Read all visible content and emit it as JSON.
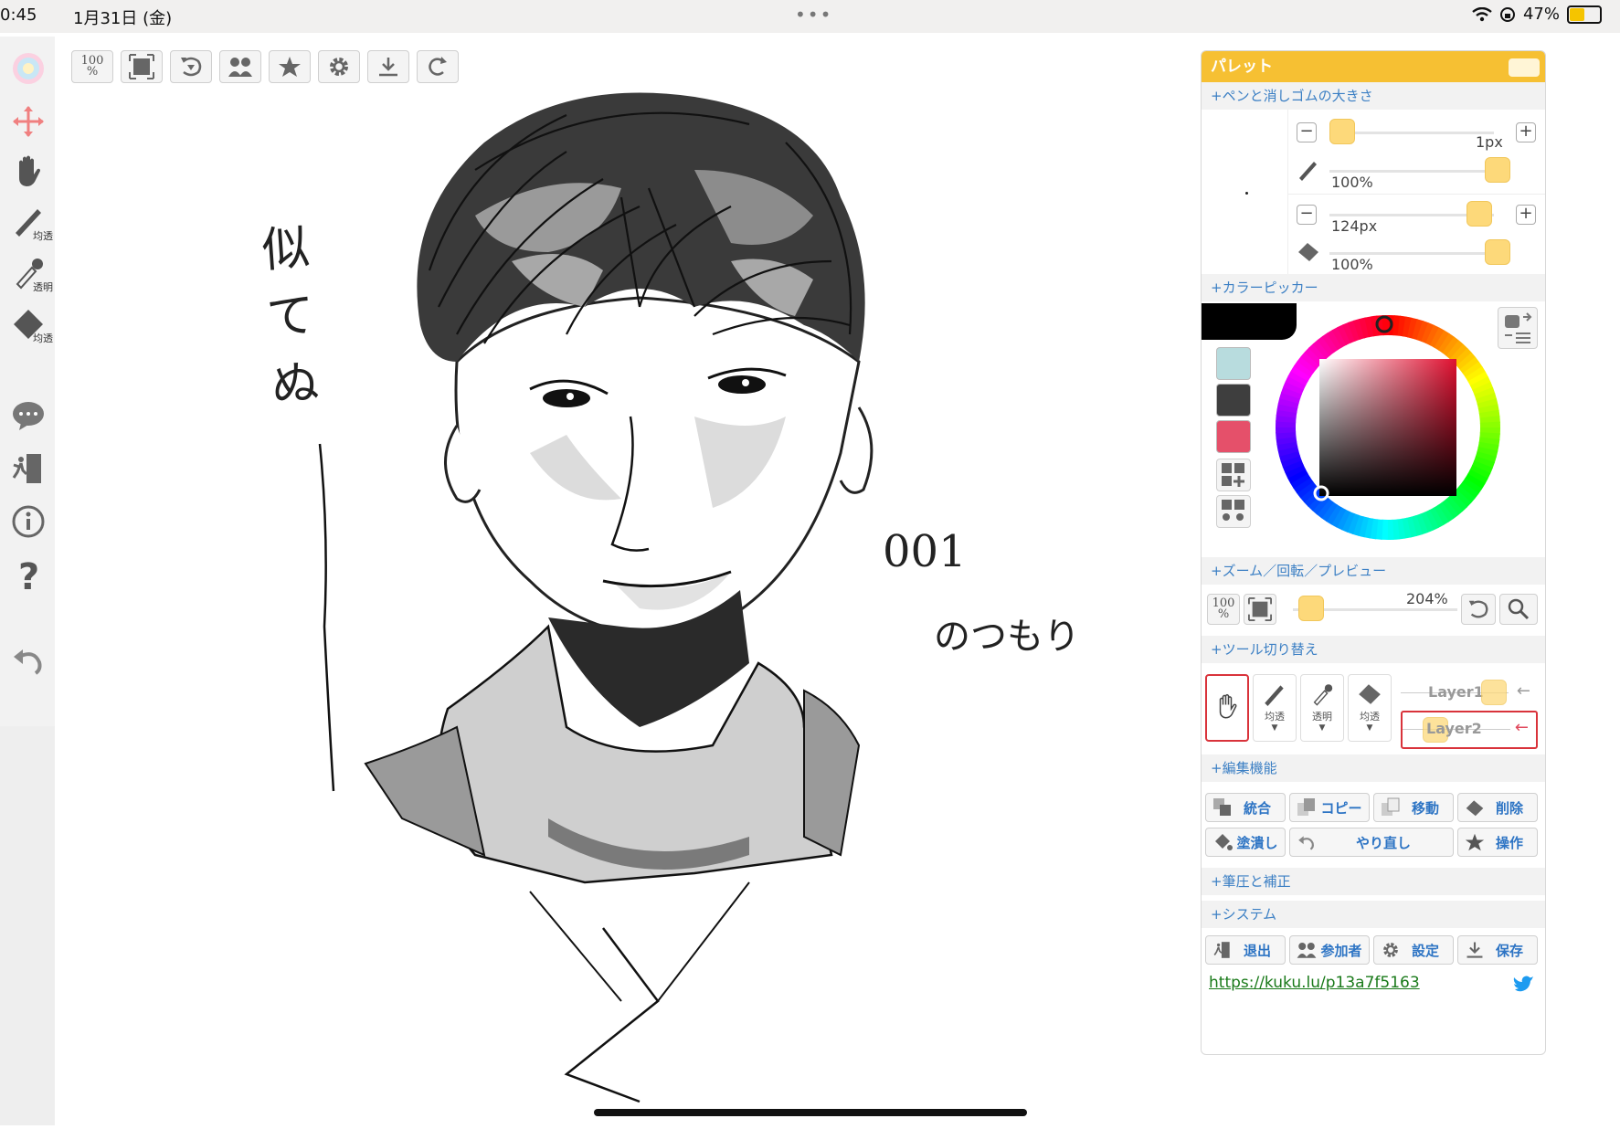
{
  "status": {
    "time": "0:45",
    "date": "1月31日 (金)",
    "dots": "•••",
    "battery": "47%"
  },
  "left_toolbar": {
    "pen_sub": "均透",
    "dropper_sub": "透明",
    "eraser_sub": "均透",
    "icons": [
      "color-wheel-icon",
      "move-icon",
      "hand-icon",
      "pen-icon",
      "dropper-icon",
      "eraser-icon",
      "chat-icon",
      "exit-icon",
      "info-icon",
      "help-icon",
      "undo-icon"
    ]
  },
  "top_toolbar": {
    "zoom_line1": "100",
    "zoom_line2": "%",
    "icons": [
      "fit-icon",
      "rotate-reset-icon",
      "participants-icon",
      "star-icon",
      "gear-icon",
      "download-icon",
      "redo-icon"
    ]
  },
  "canvas": {
    "note_left": "似\nて\nぬ",
    "note_right_1": "001",
    "note_right_2": "のつもり"
  },
  "palette": {
    "title": "パレット",
    "sections": {
      "brush_size": "+ペンと消しゴムの大きさ",
      "color_picker": "+カラーピッカー",
      "zoom": "+ズーム／回転／プレビュー",
      "tool_switch": "+ツール切り替え",
      "edit": "+編集機能",
      "pressure": "+筆圧と補正",
      "system": "+システム"
    },
    "pen": {
      "size": "1px",
      "opacity": "100%"
    },
    "eraser": {
      "size": "124px",
      "opacity": "100%"
    },
    "colors": {
      "current": "#000000",
      "swatch1": "#b8dcde",
      "swatch2": "#3e3e3e",
      "swatch3": "#e5506a"
    },
    "zoom": {
      "value": "204%",
      "line1": "100",
      "line2": "%"
    },
    "tools": {
      "pen_sub": "均透",
      "dropper_sub": "透明",
      "eraser_sub": "均透",
      "caret": "▼"
    },
    "layers": {
      "layer1": "Layer1",
      "layer2": "Layer2",
      "arrow": "←"
    },
    "edit_buttons": {
      "merge": "統合",
      "copy": "コピー",
      "move": "移動",
      "delete": "削除",
      "fill": "塗潰し",
      "redo": "やり直し",
      "operate": "操作"
    },
    "system_buttons": {
      "exit": "退出",
      "participants": "参加者",
      "settings": "設定",
      "save": "保存"
    },
    "url": "https://kuku.lu/p13a7f5163"
  }
}
